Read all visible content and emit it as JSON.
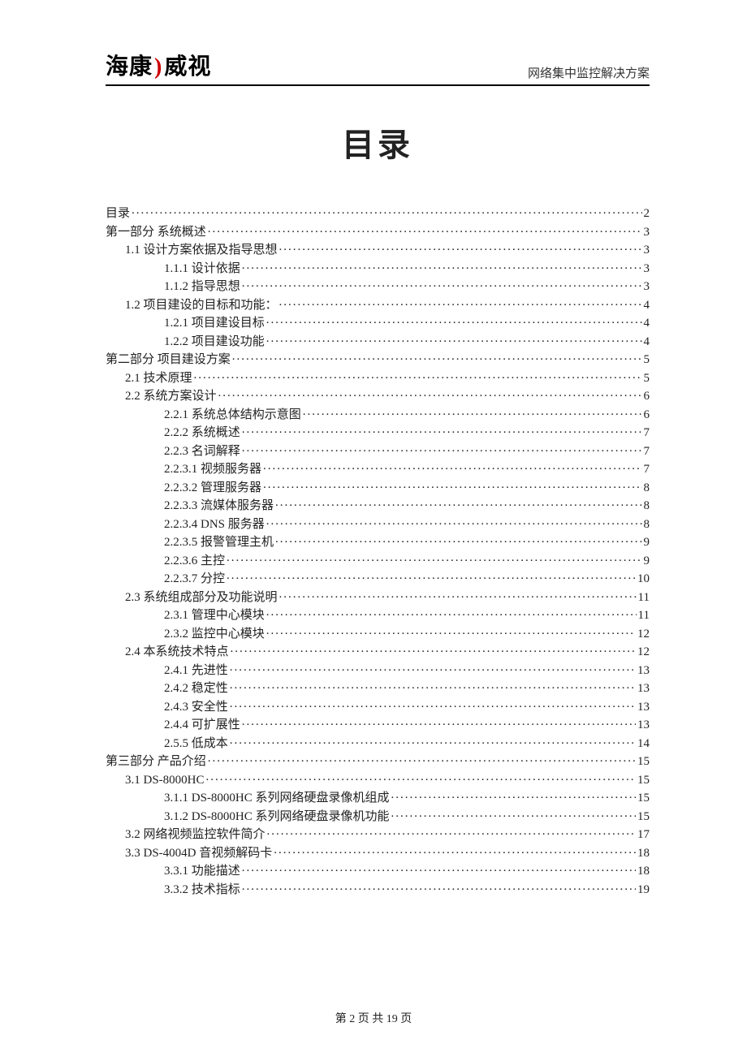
{
  "header": {
    "logo_left": "海康",
    "logo_arc": ")",
    "logo_right": "威视",
    "doc_subtitle": "网络集中监控解决方案"
  },
  "title": "目录",
  "toc": [
    {
      "label": "目录",
      "page": "2",
      "level": 0
    },
    {
      "label": "第一部分  系统概述",
      "page": "3",
      "level": 0
    },
    {
      "label": "1.1  设计方案依据及指导思想",
      "page": "3",
      "level": 1
    },
    {
      "label": "1.1.1  设计依据",
      "page": "3",
      "level": 2
    },
    {
      "label": "1.1.2  指导思想",
      "page": "3",
      "level": 2
    },
    {
      "label": "1.2  项目建设的目标和功能：",
      "page": "4",
      "level": 1
    },
    {
      "label": "1.2.1  项目建设目标",
      "page": "4",
      "level": 2
    },
    {
      "label": "1.2.2  项目建设功能",
      "page": "4",
      "level": 2
    },
    {
      "label": "第二部分  项目建设方案",
      "page": "5",
      "level": 0
    },
    {
      "label": "2.1  技术原理",
      "page": "5",
      "level": 1
    },
    {
      "label": "2.2  系统方案设计",
      "page": "6",
      "level": 1
    },
    {
      "label": "2.2.1  系统总体结构示意图",
      "page": "6",
      "level": 2
    },
    {
      "label": "2.2.2  系统概述",
      "page": "7",
      "level": 2
    },
    {
      "label": "2.2.3  名词解释",
      "page": "7",
      "level": 2
    },
    {
      "label": "2.2.3.1  视频服务器",
      "page": "7",
      "level": 2
    },
    {
      "label": "2.2.3.2 管理服务器",
      "page": "8",
      "level": 2
    },
    {
      "label": "2.2.3.3 流媒体服务器",
      "page": "8",
      "level": 2
    },
    {
      "label": "2.2.3.4 DNS 服务器",
      "page": "8",
      "level": 2
    },
    {
      "label": "2.2.3.5  报警管理主机",
      "page": "9",
      "level": 2
    },
    {
      "label": "2.2.3.6  主控",
      "page": "9",
      "level": 2
    },
    {
      "label": "2.2.3.7 分控",
      "page": "10",
      "level": 2
    },
    {
      "label": "2.3  系统组成部分及功能说明",
      "page": "11",
      "level": 1
    },
    {
      "label": "2.3.1  管理中心模块",
      "page": "11",
      "level": 2
    },
    {
      "label": "2.3.2  监控中心模块",
      "page": "12",
      "level": 2
    },
    {
      "label": "2.4  本系统技术特点",
      "page": "12",
      "level": 1
    },
    {
      "label": "2.4.1  先进性",
      "page": "13",
      "level": 2
    },
    {
      "label": "2.4.2  稳定性",
      "page": "13",
      "level": 2
    },
    {
      "label": "2.4.3  安全性",
      "page": "13",
      "level": 2
    },
    {
      "label": "2.4.4  可扩展性",
      "page": "13",
      "level": 2
    },
    {
      "label": "2.5.5  低成本",
      "page": "14",
      "level": 2
    },
    {
      "label": "第三部分  产品介绍",
      "page": "15",
      "level": 0
    },
    {
      "label": "3.1 DS-8000HC",
      "page": "15",
      "level": 1
    },
    {
      "label": "3.1.1    DS-8000HC 系列网络硬盘录像机组成",
      "page": "15",
      "level": 2
    },
    {
      "label": "3.1.2    DS-8000HC 系列网络硬盘录像机功能",
      "page": "15",
      "level": 2
    },
    {
      "label": "3.2 网络视频监控软件简介",
      "page": "17",
      "level": 1
    },
    {
      "label": "3.3 DS-4004D 音视频解码卡",
      "page": "18",
      "level": 1
    },
    {
      "label": "3.3.1 功能描述",
      "page": "18",
      "level": 2
    },
    {
      "label": "3.3.2 技术指标",
      "page": "19",
      "level": 2
    }
  ],
  "footer": {
    "prefix": "第",
    "current": "2",
    "mid": "页 共",
    "total": "19",
    "suffix": "页"
  }
}
